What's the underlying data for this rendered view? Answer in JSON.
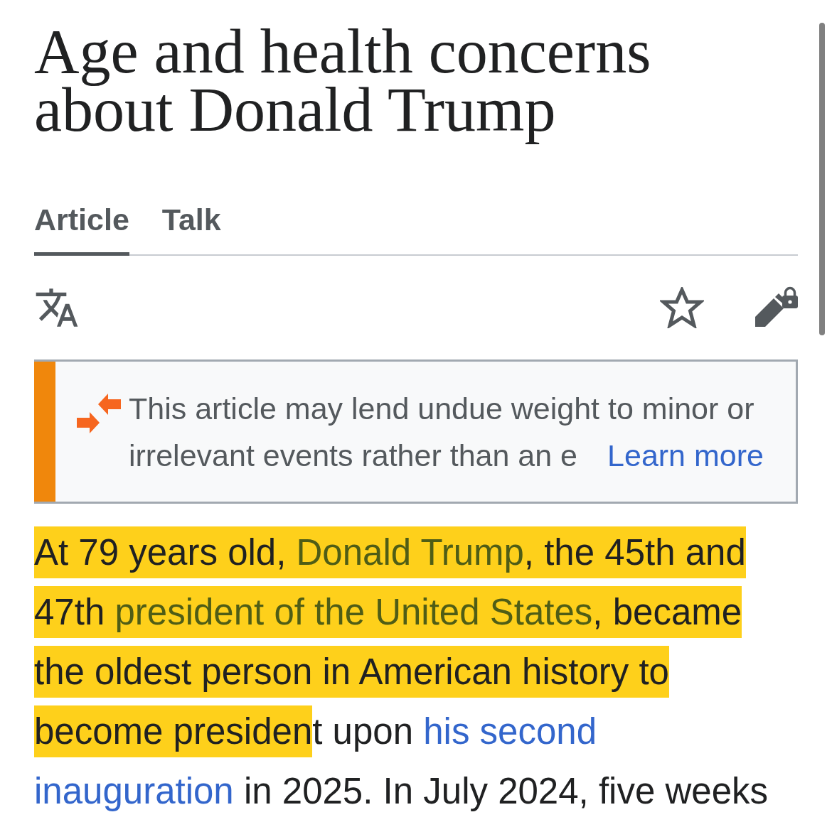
{
  "article": {
    "title": "Age and health concerns about Donald Trump"
  },
  "tabs": [
    {
      "label": "Article",
      "selected": true
    },
    {
      "label": "Talk",
      "selected": false
    }
  ],
  "notice": {
    "text": "This article may lend undue weight to minor or irrelevant events rather than an e",
    "link": "Learn more"
  },
  "paragraph": {
    "segments": [
      {
        "kind": "text",
        "text": "At 79 years old, ",
        "highlighted": true
      },
      {
        "kind": "link",
        "text": "Donald Trump",
        "highlighted": true
      },
      {
        "kind": "text",
        "text": ", the 45th and 47th ",
        "highlighted": true
      },
      {
        "kind": "link",
        "text": "president of the United States",
        "highlighted": true
      },
      {
        "kind": "text",
        "text": ", became the oldest person in American history to become presiden",
        "highlighted": true
      },
      {
        "kind": "text",
        "text": "t upon ",
        "highlighted": false
      },
      {
        "kind": "link",
        "text": "his second ",
        "highlighted": false
      },
      {
        "kind": "link",
        "text": "inauguration",
        "highlighted": false
      },
      {
        "kind": "text",
        "text": " in 2025. In July 2024, five weeks",
        "highlighted": false
      }
    ]
  }
}
